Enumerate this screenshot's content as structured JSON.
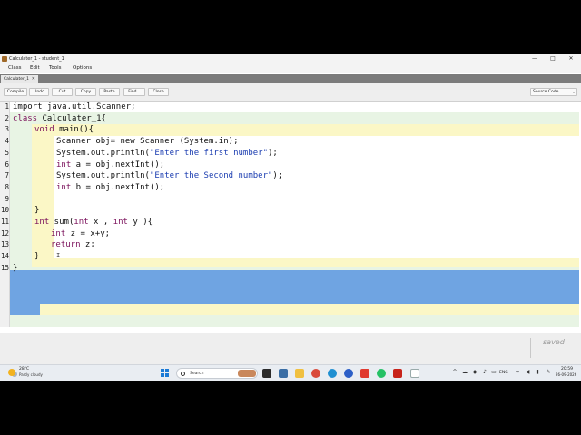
{
  "window": {
    "title": "Calculater_1 - student_1",
    "min_glyph": "—",
    "max_glyph": "□",
    "close_glyph": "✕"
  },
  "menu": [
    "Class",
    "Edit",
    "Tools",
    "Options"
  ],
  "tab": {
    "label": "Calculater_1",
    "close_glyph": "✕"
  },
  "toolbar": {
    "buttons": [
      "Compile",
      "Undo",
      "Cut",
      "Copy",
      "Paste",
      "Find...",
      "Close"
    ],
    "view_select": "Source Code",
    "view_select_arrow": "▾"
  },
  "editor": {
    "line_numbers": [
      "1",
      "2",
      "3",
      "4",
      "5",
      "6",
      "7",
      "8",
      "9",
      "10",
      "11",
      "12",
      "13",
      "14",
      "15"
    ],
    "code": {
      "l1": "import java.util.Scanner;",
      "l2_kw": "class",
      "l2_rest": " Calculater_1{",
      "l3_kw": "void",
      "l3_rest": " main(){",
      "l4": "Scanner obj= new Scanner (System.in);",
      "l5_a": "System.out.println(",
      "l5_str": "\"Enter the first number\"",
      "l5_b": ");",
      "l6_kw": "int",
      "l6_rest": " a = obj.nextInt();",
      "l7_a": "System.out.println(",
      "l7_str": "\"Enter the Second number\"",
      "l7_b": ");",
      "l8_kw": "int",
      "l8_rest": " b = obj.nextInt();",
      "l10": "}",
      "l11_kw1": "int",
      "l11_a": " sum(",
      "l11_kw2": "int",
      "l11_b": " x , ",
      "l11_kw3": "int",
      "l11_c": " y ){",
      "l12_kw": "int",
      "l12_rest": " z = x+y;",
      "l13_kw": "return",
      "l13_rest": " z;",
      "l14": "}",
      "l15": "}"
    },
    "selected_lines": "11-14",
    "cursor_glyph": "I"
  },
  "status": {
    "saved": "saved"
  },
  "taskbar": {
    "weather_temp": "28°C",
    "weather_desc": "Partly cloudy",
    "search_placeholder": "Search",
    "language": "ENG",
    "time": "20:59",
    "date": "26-09-2026"
  },
  "colors": {
    "class_scope": "#e8f4e4",
    "method_scope": "#fbf7c6",
    "method_body": "#ffffff",
    "selection": "#6fa4e2",
    "keyword": "#7a0f5a",
    "string": "#1a3cb0"
  }
}
